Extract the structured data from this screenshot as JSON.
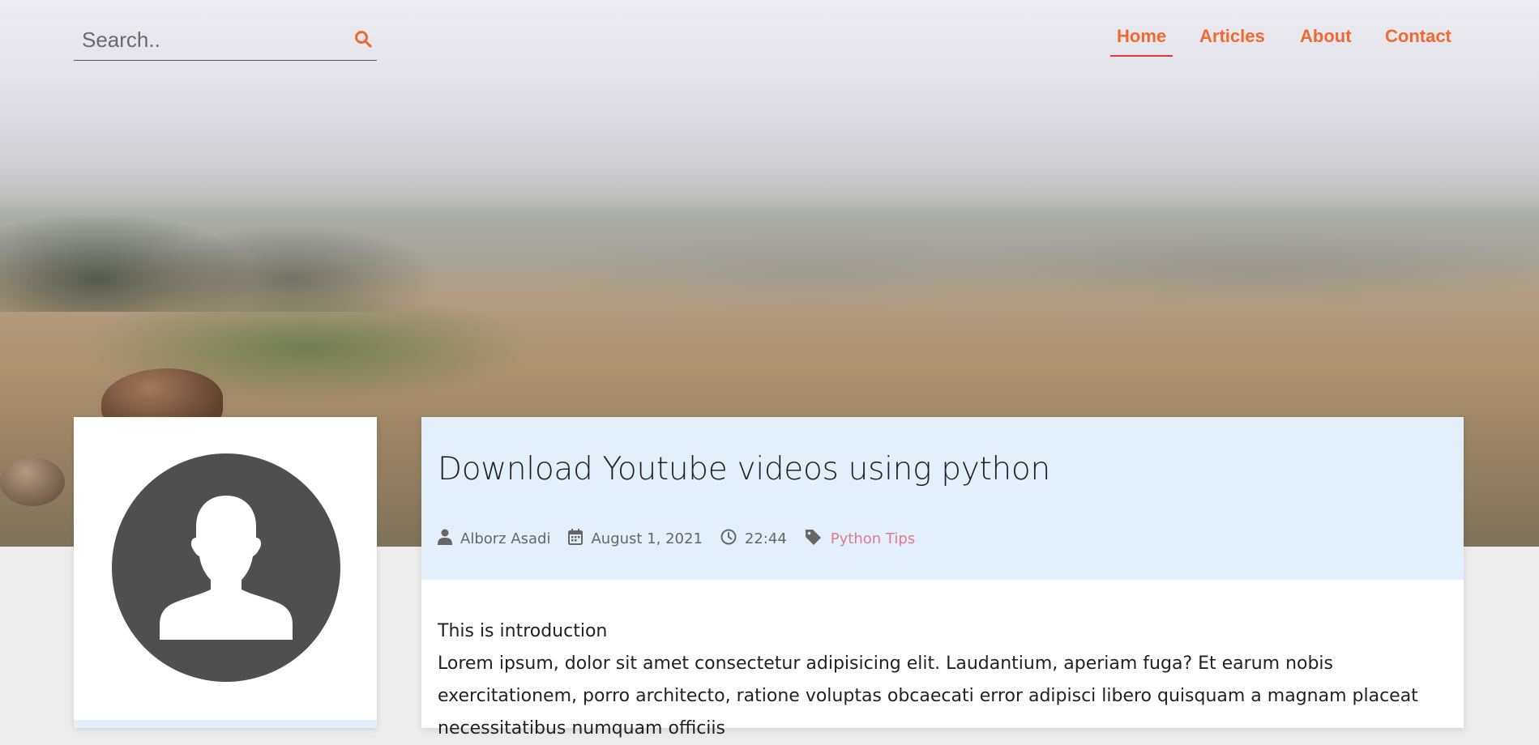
{
  "search": {
    "placeholder": "Search.."
  },
  "nav": {
    "items": [
      {
        "label": "Home",
        "active": true
      },
      {
        "label": "Articles",
        "active": false
      },
      {
        "label": "About",
        "active": false
      },
      {
        "label": "Contact",
        "active": false
      }
    ]
  },
  "article": {
    "title": "Download Youtube videos using python",
    "author": "Alborz Asadi",
    "date": "August 1, 2021",
    "time": "22:44",
    "tag": "Python Tips",
    "intro": "This is introduction",
    "body": "Lorem ipsum, dolor sit amet consectetur adipisicing elit. Laudantium, aperiam fuga? Et earum nobis exercitationem, porro architecto, ratione voluptas obcaecati error adipisci libero quisquam a magnam placeat necessitatibus numquam officiis"
  },
  "colors": {
    "accent": "#ef6a30",
    "active_underline": "#e03a3a",
    "tag": "#e07a90",
    "article_header_bg": "#e3f0fb",
    "avatar_bg": "#4f4f4f"
  },
  "icons": {
    "search": "search-icon",
    "author": "user-icon",
    "date": "calendar-icon",
    "time": "clock-icon",
    "tag": "tag-icon",
    "avatar": "avatar-placeholder-icon"
  }
}
